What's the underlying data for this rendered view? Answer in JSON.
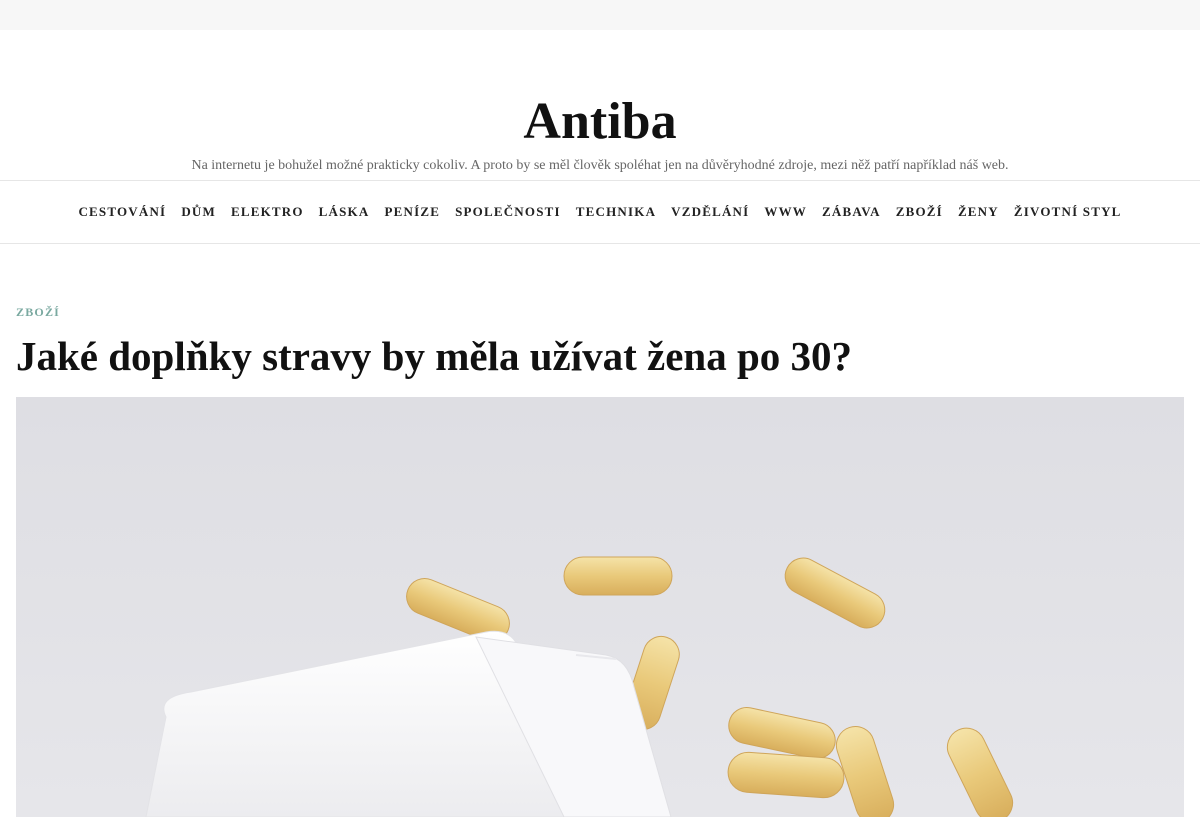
{
  "site": {
    "title": "Antiba",
    "description": "Na internetu je bohužel možné prakticky cokoliv. A proto by se měl člověk spoléhat jen na důvěryhodné zdroje, mezi něž patří například náš web."
  },
  "nav": {
    "items": [
      {
        "label": "CESTOVÁNÍ"
      },
      {
        "label": "DŮM"
      },
      {
        "label": "ELEKTRO"
      },
      {
        "label": "LÁSKA"
      },
      {
        "label": "PENÍZE"
      },
      {
        "label": "SPOLEČNOSTI"
      },
      {
        "label": "TECHNIKA"
      },
      {
        "label": "VZDĚLÁNÍ"
      },
      {
        "label": "WWW"
      },
      {
        "label": "ZÁBAVA"
      },
      {
        "label": "ZBOŽÍ"
      },
      {
        "label": "ŽENY"
      },
      {
        "label": "ŽIVOTNÍ STYL"
      }
    ]
  },
  "article": {
    "category": "ZBOŽÍ",
    "title": "Jaké doplňky stravy by měla užívat žena po 30?",
    "image": {
      "subject": "pill-bottle-with-softgel-capsules",
      "background_color": "#e2e2e6",
      "bottle_color": "#fbfbfb",
      "capsule_color": "#e9c97a"
    }
  }
}
